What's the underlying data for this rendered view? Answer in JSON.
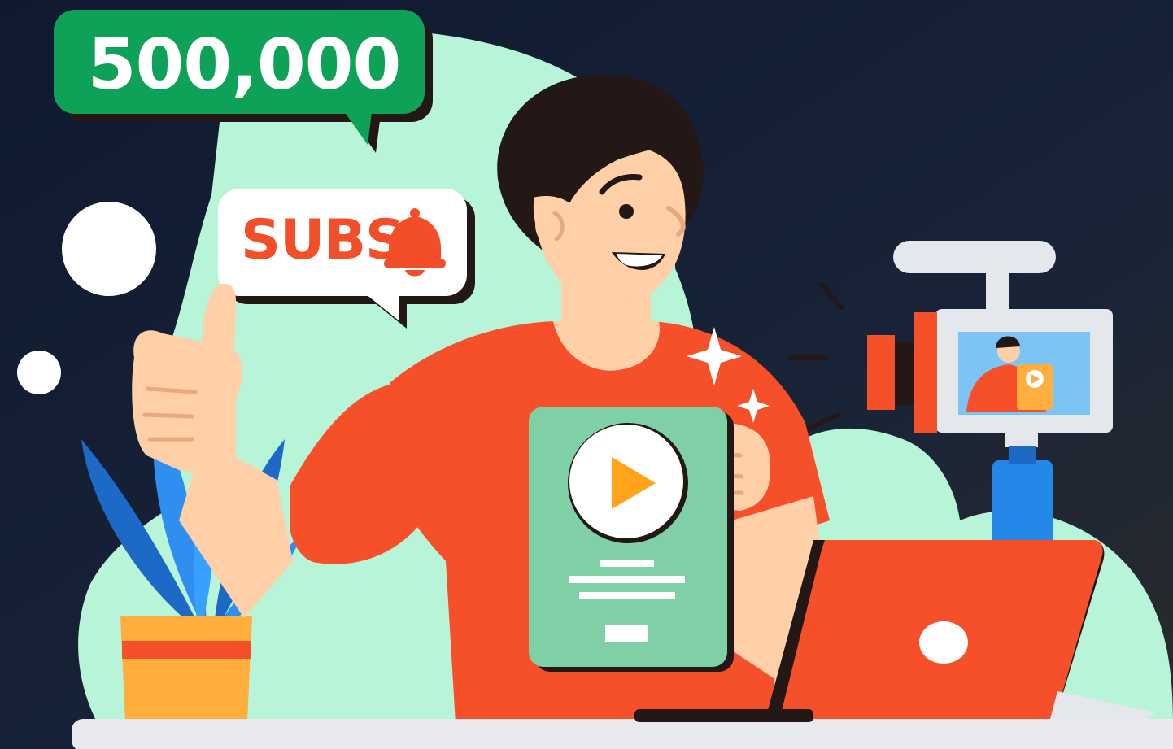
{
  "illustration": {
    "subscriber_bubble": {
      "count": "500,000"
    },
    "subs_bubble": {
      "label": "SUBS",
      "icon": "bell-icon"
    },
    "play_card": {
      "icon": "play-icon"
    },
    "camera_preview": {
      "icon": "play-icon"
    }
  },
  "colors": {
    "background_left": "#0f1a30",
    "background_right": "#2a2c2c",
    "blob": "#b8f5d8",
    "shirt": "#f6502b",
    "skin": "#ffcfa8",
    "hair": "#231816",
    "card": "#7fd0a6",
    "play_triangle": "#ffa31a",
    "count_bubble": "#0ea158",
    "subs_text": "#f24e2a",
    "laptop": "#f6502b",
    "plant_leaves": "#2e8ff0",
    "pot": "#ffad3d",
    "camera_body": "#e4e7ec",
    "camera_screen": "#7cc4f5",
    "tripod": "#2488e8",
    "desk": "#e9eaee"
  }
}
